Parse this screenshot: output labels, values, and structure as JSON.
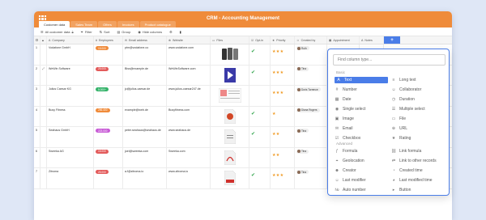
{
  "app": {
    "title": "CRM - Accounting Management"
  },
  "tabs": [
    "Customer data",
    "Sales Team",
    "Offers",
    "Invoices",
    "Product catalogue"
  ],
  "toolbar": {
    "view": "All customer data",
    "filter": "Filter",
    "sort": "Sort",
    "group": "Group",
    "hide": "Hide columns"
  },
  "columns": [
    {
      "label": "Company",
      "icon": "text-icon"
    },
    {
      "label": "Employees",
      "icon": "number-icon"
    },
    {
      "label": "Email address",
      "icon": "email-icon"
    },
    {
      "label": "Website",
      "icon": "url-icon"
    },
    {
      "label": "Files",
      "icon": "file-icon"
    },
    {
      "label": "Opt-in",
      "icon": "checkbox-icon"
    },
    {
      "label": "Priority",
      "icon": "rating-icon"
    },
    {
      "label": "Created by",
      "icon": "creator-icon"
    },
    {
      "label": "Appointment",
      "icon": "date-icon"
    },
    {
      "label": "Notes",
      "icon": "text-icon"
    }
  ],
  "rows": [
    {
      "num": "1",
      "company": "Vodafone GmbH",
      "employees": "15.000",
      "emp_color": "#f08b3a",
      "email": "ptm@vodafone.co",
      "website": "www.vodafone.com",
      "optin": true,
      "stars": "★★★",
      "user": "Ruth",
      "file": "phones"
    },
    {
      "num": "2",
      "company": "WeWin Software",
      "employees": "25.000",
      "emp_color": "#e35b5b",
      "email": "Biss@example.de",
      "website": "WeWinSoftware.com",
      "optin": true,
      "stars": "★★★",
      "user": "Tina",
      "file": "video"
    },
    {
      "num": "3",
      "company": "Julius Caesar KG",
      "employees": "5.000+",
      "emp_color": "#35b36a",
      "email": "jc@julius-caesar.de",
      "website": "www.julius-caesar247.de",
      "optin": false,
      "stars": "★★★",
      "user": "Doris Torrence",
      "file": "doc"
    },
    {
      "num": "4",
      "company": "Busy Fitness",
      "employees": "256.400",
      "emp_color": "#f08b3a",
      "email": "example@web.de",
      "website": "Busyfitness.com",
      "optin": true,
      "stars": "★",
      "user": "Diana Rogers",
      "file": "ppt"
    },
    {
      "num": "5",
      "company": "Seahaus GmbH",
      "employees": "223.000",
      "emp_color": "#c85bd6",
      "email": "peter.seahaus@seahaus.de",
      "website": "www.seahaus.de",
      "optin": true,
      "stars": "★★",
      "user": "Tina",
      "file": "doc2"
    },
    {
      "num": "6",
      "company": "Sweeka AG",
      "employees": "15.000",
      "emp_color": "#e35b5b",
      "email": "joel@sweeka.com",
      "website": "Sweeka.com",
      "optin": false,
      "stars": "★★",
      "user": "Tina",
      "file": "pdf"
    },
    {
      "num": "7",
      "company": "Zitroma",
      "employees": "25.000",
      "emp_color": "#e35b5b",
      "email": "a.f@zitroma.io",
      "website": "www.zitroma.io",
      "optin": true,
      "stars": "★★★",
      "user": "Tina",
      "file": "pdf2"
    }
  ],
  "popup": {
    "placeholder": "Find column type...",
    "basic_label": "Basic",
    "advanced_label": "Advanced",
    "basic": [
      {
        "label": "Text",
        "icon": "text-icon",
        "selected": true
      },
      {
        "label": "Long text",
        "icon": "long-text-icon"
      },
      {
        "label": "Number",
        "icon": "number-icon"
      },
      {
        "label": "Collaborator",
        "icon": "collaborator-icon"
      },
      {
        "label": "Date",
        "icon": "date-icon"
      },
      {
        "label": "Duration",
        "icon": "duration-icon"
      },
      {
        "label": "Single select",
        "icon": "single-select-icon"
      },
      {
        "label": "Multiple select",
        "icon": "multiple-select-icon"
      },
      {
        "label": "Image",
        "icon": "image-icon"
      },
      {
        "label": "File",
        "icon": "file-icon"
      },
      {
        "label": "Email",
        "icon": "email-icon"
      },
      {
        "label": "URL",
        "icon": "url-icon"
      },
      {
        "label": "Checkbox",
        "icon": "checkbox-icon"
      },
      {
        "label": "Rating",
        "icon": "rating-icon"
      }
    ],
    "advanced": [
      {
        "label": "Formula",
        "icon": "formula-icon"
      },
      {
        "label": "Link formula",
        "icon": "link-formula-icon"
      },
      {
        "label": "Geolocation",
        "icon": "geolocation-icon"
      },
      {
        "label": "Link to other records",
        "icon": "link-icon"
      },
      {
        "label": "Creator",
        "icon": "creator-icon"
      },
      {
        "label": "Created time",
        "icon": "created-time-icon"
      },
      {
        "label": "Last modifier",
        "icon": "last-modifier-icon"
      },
      {
        "label": "Last modified time",
        "icon": "last-modified-time-icon"
      },
      {
        "label": "Auto number",
        "icon": "auto-number-icon"
      },
      {
        "label": "Button",
        "icon": "button-icon"
      }
    ]
  },
  "colors": {
    "accent": "#ef8b3a",
    "primary": "#4a7de8",
    "background": "#dfe7f6"
  }
}
